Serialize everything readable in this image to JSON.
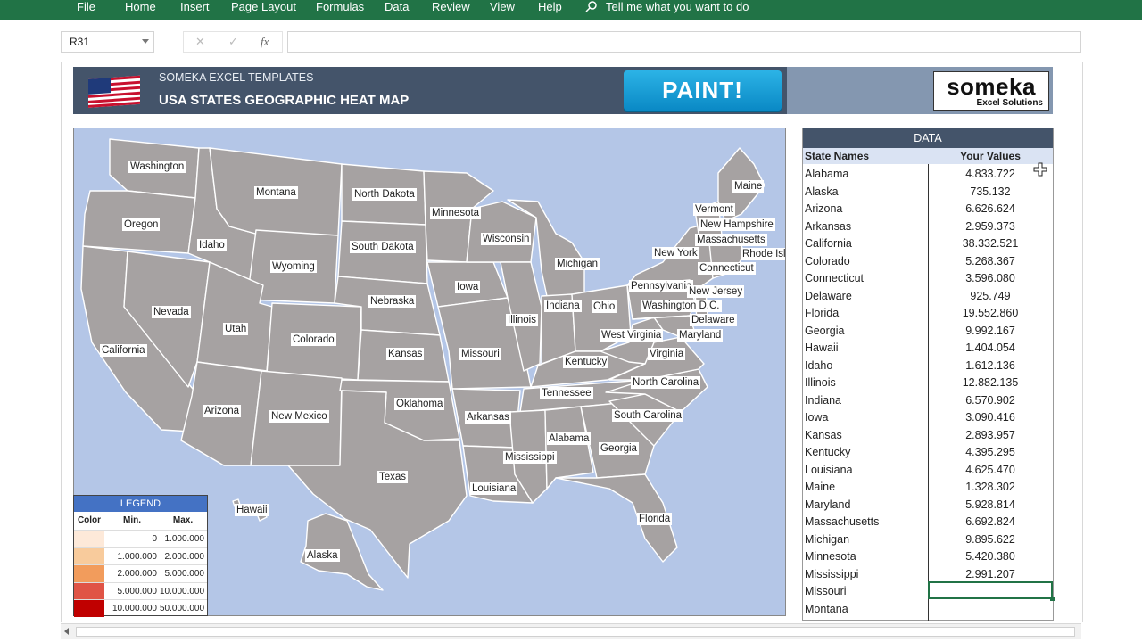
{
  "ribbon": {
    "tabs": [
      "File",
      "Home",
      "Insert",
      "Page Layout",
      "Formulas",
      "Data",
      "Review",
      "View",
      "Help"
    ],
    "tell_me": "Tell me what you want to do"
  },
  "formula_bar": {
    "name_box": "R31",
    "cancel": "✕",
    "enter": "✓",
    "fx": "fx",
    "formula": ""
  },
  "header": {
    "brand": "SOMEKA EXCEL TEMPLATES",
    "title": "USA STATES GEOGRAPHIC HEAT MAP",
    "paint_button": "PAINT!",
    "logo_main": "someka",
    "logo_sub": "Excel Solutions"
  },
  "map": {
    "fill_color": "#a6a2a2",
    "background": "#b4c6e7",
    "labels": [
      "Washington",
      "Montana",
      "North Dakota",
      "Minnesota",
      "Oregon",
      "Idaho",
      "South Dakota",
      "Wisconsin",
      "Michigan",
      "Maine",
      "Vermont",
      "New Hampshire",
      "Massachusetts",
      "Rhode Island",
      "New York",
      "Connecticut",
      "Wyoming",
      "Iowa",
      "Pennsylvania",
      "New Jersey",
      "Nevada",
      "Nebraska",
      "Illinois",
      "Indiana",
      "Ohio",
      "Washington D.C.",
      "Delaware",
      "Maryland",
      "West Virginia",
      "Utah",
      "California",
      "Colorado",
      "Kansas",
      "Missouri",
      "Virginia",
      "Kentucky",
      "North Carolina",
      "Tennessee",
      "Arizona",
      "New Mexico",
      "Oklahoma",
      "Arkansas",
      "South Carolina",
      "Alabama",
      "Georgia",
      "Mississippi",
      "Texas",
      "Louisiana",
      "Hawaii",
      "Alaska",
      "Florida"
    ]
  },
  "legend": {
    "title": "LEGEND",
    "headers": [
      "Color",
      "Min.",
      "Max."
    ],
    "rows": [
      {
        "color": "#fde9d9",
        "min": "0",
        "max": "1.000.000"
      },
      {
        "color": "#f8cb9c",
        "min": "1.000.000",
        "max": "2.000.000"
      },
      {
        "color": "#f29c5c",
        "min": "2.000.000",
        "max": "5.000.000"
      },
      {
        "color": "#e05446",
        "min": "5.000.000",
        "max": "10.000.000"
      },
      {
        "color": "#c00000",
        "min": "10.000.000",
        "max": "50.000.000"
      }
    ]
  },
  "data_panel": {
    "title": "DATA",
    "col_state": "State Names",
    "col_value": "Your Values",
    "rows": [
      {
        "state": "Alabama",
        "value": "4.833.722"
      },
      {
        "state": "Alaska",
        "value": "735.132"
      },
      {
        "state": "Arizona",
        "value": "6.626.624"
      },
      {
        "state": "Arkansas",
        "value": "2.959.373"
      },
      {
        "state": "California",
        "value": "38.332.521"
      },
      {
        "state": "Colorado",
        "value": "5.268.367"
      },
      {
        "state": "Connecticut",
        "value": "3.596.080"
      },
      {
        "state": "Delaware",
        "value": "925.749"
      },
      {
        "state": "Florida",
        "value": "19.552.860"
      },
      {
        "state": "Georgia",
        "value": "9.992.167"
      },
      {
        "state": "Hawaii",
        "value": "1.404.054"
      },
      {
        "state": "Idaho",
        "value": "1.612.136"
      },
      {
        "state": "Illinois",
        "value": "12.882.135"
      },
      {
        "state": "Indiana",
        "value": "6.570.902"
      },
      {
        "state": "Iowa",
        "value": "3.090.416"
      },
      {
        "state": "Kansas",
        "value": "2.893.957"
      },
      {
        "state": "Kentucky",
        "value": "4.395.295"
      },
      {
        "state": "Louisiana",
        "value": "4.625.470"
      },
      {
        "state": "Maine",
        "value": "1.328.302"
      },
      {
        "state": "Maryland",
        "value": "5.928.814"
      },
      {
        "state": "Massachusetts",
        "value": "6.692.824"
      },
      {
        "state": "Michigan",
        "value": "9.895.622"
      },
      {
        "state": "Minnesota",
        "value": "5.420.380"
      },
      {
        "state": "Mississippi",
        "value": "2.991.207"
      },
      {
        "state": "Missouri",
        "value": ""
      },
      {
        "state": "Montana",
        "value": ""
      }
    ]
  }
}
